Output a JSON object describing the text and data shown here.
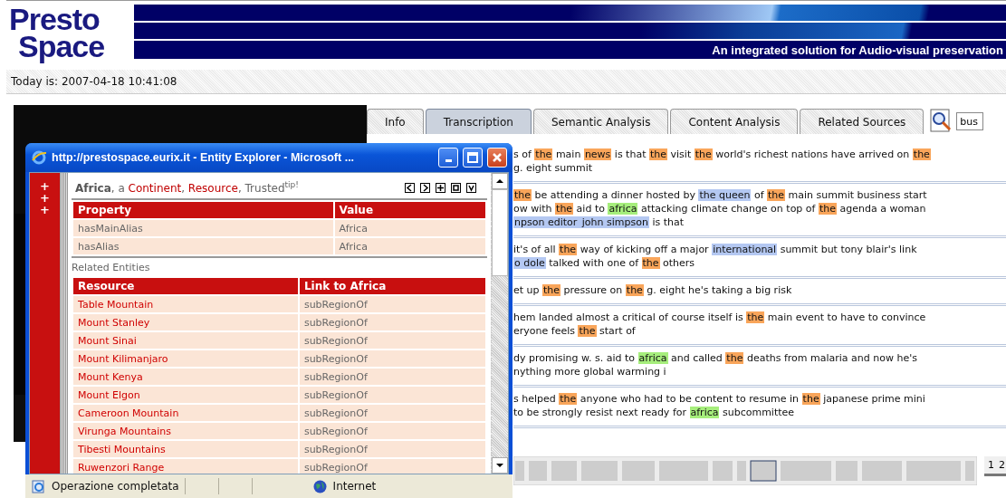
{
  "header": {
    "logo": [
      "Presto",
      "Space"
    ],
    "tagline": "An integrated solution for Audio-visual preservation"
  },
  "date": "Today is: 2007-04-18 10:41:08",
  "tabs": [
    {
      "label": "Info",
      "selected": false
    },
    {
      "label": "Transcription",
      "selected": true
    },
    {
      "label": "Semantic Analysis",
      "selected": false
    },
    {
      "label": "Content Analysis",
      "selected": false
    },
    {
      "label": "Related Sources",
      "selected": false
    }
  ],
  "search": {
    "value": "bus"
  },
  "transcript": {
    "segments": [
      {
        "lines": [
          [
            {
              "text": "s of "
            },
            {
              "text": "the",
              "color": "#f9a55a"
            },
            {
              "text": " main "
            },
            {
              "text": "news",
              "color": "#f9a55a"
            },
            {
              "text": " is that "
            },
            {
              "text": "the",
              "color": "#f9a55a"
            },
            {
              "text": " visit "
            },
            {
              "text": "the",
              "color": "#f9a55a"
            },
            {
              "text": " world's richest nations have arrived on "
            },
            {
              "text": "the",
              "color": "#f9a55a"
            }
          ],
          [
            {
              "text": "g. eight summit"
            }
          ]
        ]
      },
      {
        "lines": [
          [
            {
              "text": "the",
              "color": "#f9a55a"
            },
            {
              "text": " be attending a dinner hosted by "
            },
            {
              "text": "the queen",
              "color": "#b4c8f2"
            },
            {
              "text": " of "
            },
            {
              "text": "the",
              "color": "#f9a55a"
            },
            {
              "text": " main summit business start"
            }
          ],
          [
            {
              "text": "ow with "
            },
            {
              "text": "the",
              "color": "#f9a55a"
            },
            {
              "text": " aid to "
            },
            {
              "text": "africa",
              "color": "#a6ee7c"
            },
            {
              "text": " attacking climate change on top of "
            },
            {
              "text": "the",
              "color": "#f9a55a"
            },
            {
              "text": " agenda a woman"
            }
          ],
          [
            {
              "text": "npson editor ",
              "color": "#b4c8f2"
            },
            {
              "text": "john simpson",
              "color": "#b4c8f2"
            },
            {
              "text": " is that"
            }
          ]
        ]
      },
      {
        "lines": [
          [
            {
              "text": "it's of all "
            },
            {
              "text": "the",
              "color": "#f9a55a"
            },
            {
              "text": " way of kicking off a major "
            },
            {
              "text": "international",
              "color": "#b4c8f2"
            },
            {
              "text": " summit but tony blair's link"
            }
          ],
          [
            {
              "text": "o dole",
              "color": "#b4c8f2"
            },
            {
              "text": " talked with one of "
            },
            {
              "text": "the",
              "color": "#f9a55a"
            },
            {
              "text": " others"
            }
          ]
        ]
      },
      {
        "lines": [
          [
            {
              "text": "et up "
            },
            {
              "text": "the",
              "color": "#f9a55a"
            },
            {
              "text": " pressure on "
            },
            {
              "text": "the",
              "color": "#f9a55a"
            },
            {
              "text": " g. eight he's taking a big risk"
            }
          ]
        ]
      },
      {
        "lines": [
          [
            {
              "text": "hem landed almost a critical of course itself is "
            },
            {
              "text": "the",
              "color": "#f9a55a"
            },
            {
              "text": " main event to have to convince"
            }
          ],
          [
            {
              "text": "eryone feels "
            },
            {
              "text": "the",
              "color": "#f9a55a"
            },
            {
              "text": " start of"
            }
          ]
        ]
      },
      {
        "lines": [
          [
            {
              "text": "dy promising w. s. aid to "
            },
            {
              "text": "africa",
              "color": "#a6ee7c"
            },
            {
              "text": " and called "
            },
            {
              "text": "the",
              "color": "#f9a55a"
            },
            {
              "text": " deaths from malaria and now he's"
            }
          ],
          [
            {
              "text": "nything more global warming i"
            }
          ]
        ]
      },
      {
        "lines": [
          [
            {
              "text": "s helped "
            },
            {
              "text": "the",
              "color": "#f9a55a"
            },
            {
              "text": " anyone who had to be content to resume in "
            },
            {
              "text": "the",
              "color": "#f9a55a"
            },
            {
              "text": " japanese prime mini"
            }
          ],
          [
            {
              "text": "to be strongly resist next ready for "
            },
            {
              "text": "africa",
              "color": "#a6ee7c"
            },
            {
              "text": " subcommittee"
            }
          ]
        ]
      }
    ]
  },
  "pager": [
    "1",
    "2"
  ],
  "popup": {
    "title": "http://prestospace.eurix.it - Entity Explorer - Microsoft ...",
    "expand_buttons": [
      "+",
      "+",
      "+"
    ],
    "heading": {
      "before": "**Africa**, a ",
      "types": [
        "Continent",
        "Resource"
      ],
      "type_separator": ", ",
      "after": ", Trusted$^{tip!}$"
    },
    "properties": {
      "columns": [
        "Property",
        "Value"
      ],
      "rows": [
        [
          "hasMainAlias",
          "Africa"
        ],
        [
          "hasAlias",
          "Africa"
        ]
      ]
    },
    "related_label": "Related Entities",
    "related": {
      "columns": [
        "Resource",
        "Link to Africa"
      ],
      "rows": [
        [
          "Table Mountain",
          "subRegionOf"
        ],
        [
          "Mount Stanley",
          "subRegionOf"
        ],
        [
          "Mount Sinai",
          "subRegionOf"
        ],
        [
          "Mount Kilimanjaro",
          "subRegionOf"
        ],
        [
          "Mount Kenya",
          "subRegionOf"
        ],
        [
          "Mount Elgon",
          "subRegionOf"
        ],
        [
          "Cameroon Mountain",
          "subRegionOf"
        ],
        [
          "Virunga Mountains",
          "subRegionOf"
        ],
        [
          "Tibesti Mountains",
          "subRegionOf"
        ],
        [
          "Ruwenzori Range",
          "subRegionOf"
        ]
      ]
    },
    "status": {
      "text": "Operazione completata",
      "zone": "Internet"
    }
  }
}
